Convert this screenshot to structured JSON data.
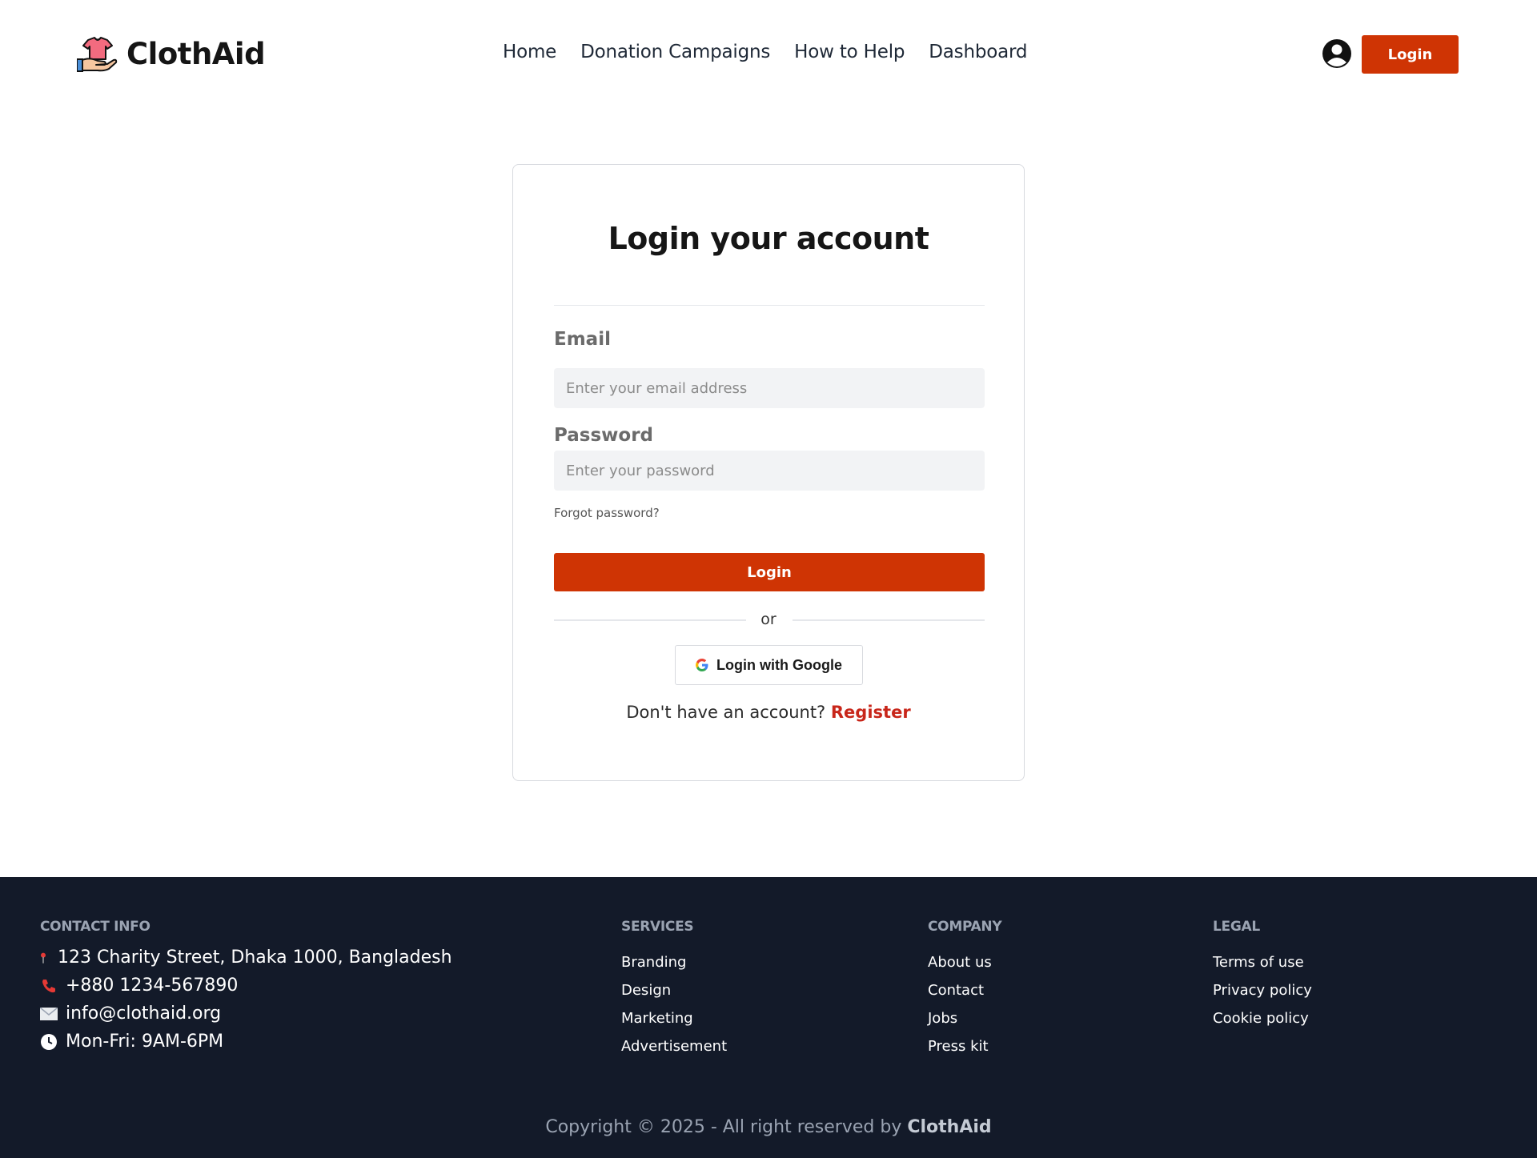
{
  "header": {
    "brand": "ClothAid",
    "nav": [
      "Home",
      "Donation Campaigns",
      "How to Help",
      "Dashboard"
    ],
    "login_label": "Login"
  },
  "login_card": {
    "title": "Login your account",
    "email_label": "Email",
    "email_placeholder": "Enter your email address",
    "password_label": "Password",
    "password_placeholder": "Enter your password",
    "forgot_label": "Forgot password?",
    "login_label": "Login",
    "or_label": "or",
    "google_label": "Login with Google",
    "register_prompt": "Don't have an account?",
    "register_label": "Register"
  },
  "footer": {
    "contact": {
      "title": "CONTACT INFO",
      "address": "123 Charity Street, Dhaka 1000, Bangladesh",
      "phone": "+880 1234-567890",
      "email": "info@clothaid.org",
      "hours": "Mon-Fri: 9AM-6PM"
    },
    "services": {
      "title": "SERVICES",
      "links": [
        "Branding",
        "Design",
        "Marketing",
        "Advertisement"
      ]
    },
    "company": {
      "title": "COMPANY",
      "links": [
        "About us",
        "Contact",
        "Jobs",
        "Press kit"
      ]
    },
    "legal": {
      "title": "LEGAL",
      "links": [
        "Terms of use",
        "Privacy policy",
        "Cookie policy"
      ]
    },
    "copyright_text": "Copyright © 2025 - All right reserved by",
    "copyright_brand": "ClothAid"
  },
  "colors": {
    "accent": "#cf3404",
    "register_link": "#c8261a",
    "footer_bg": "#131a29"
  },
  "icons": {
    "logo": "hand-shirt-icon",
    "user": "user-circle-icon",
    "google": "google-icon",
    "address": "pin-icon",
    "phone": "phone-icon",
    "email": "envelope-icon",
    "hours": "clock-icon"
  }
}
